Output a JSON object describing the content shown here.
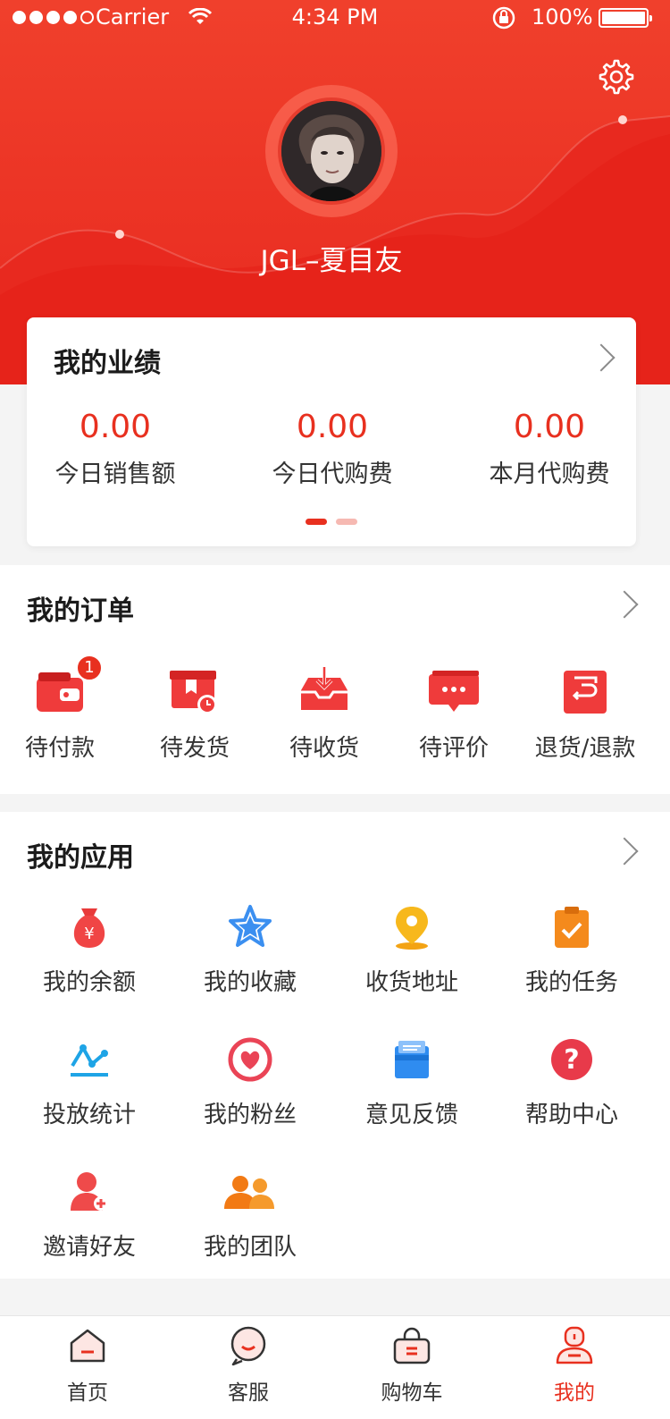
{
  "status_bar": {
    "carrier": "Carrier",
    "time": "4:34 PM",
    "battery": "100%"
  },
  "profile": {
    "username": "JGL–夏目友"
  },
  "performance": {
    "title": "我的业绩",
    "stats": [
      {
        "value": "0.00",
        "label": "今日销售额"
      },
      {
        "value": "0.00",
        "label": "今日代购费"
      },
      {
        "value": "0.00",
        "label": "本月代购费"
      }
    ]
  },
  "orders": {
    "title": "我的订单",
    "items": [
      {
        "label": "待付款",
        "icon": "wallet-icon",
        "badge": "1"
      },
      {
        "label": "待发货",
        "icon": "box-clock-icon"
      },
      {
        "label": "待收货",
        "icon": "inbox-icon"
      },
      {
        "label": "待评价",
        "icon": "chat-icon"
      },
      {
        "label": "退货/退款",
        "icon": "return-icon"
      }
    ]
  },
  "apps": {
    "title": "我的应用",
    "items": [
      {
        "label": "我的余额",
        "icon": "money-bag-icon"
      },
      {
        "label": "我的收藏",
        "icon": "star-icon"
      },
      {
        "label": "收货地址",
        "icon": "location-pin-icon"
      },
      {
        "label": "我的任务",
        "icon": "clipboard-check-icon"
      },
      {
        "label": "投放统计",
        "icon": "line-stats-icon"
      },
      {
        "label": "我的粉丝",
        "icon": "heart-icon"
      },
      {
        "label": "意见反馈",
        "icon": "feedback-icon"
      },
      {
        "label": "帮助中心",
        "icon": "help-icon"
      },
      {
        "label": "邀请好友",
        "icon": "add-user-icon"
      },
      {
        "label": "我的团队",
        "icon": "team-icon"
      }
    ]
  },
  "tabbar": {
    "items": [
      {
        "label": "首页",
        "icon": "home-icon"
      },
      {
        "label": "客服",
        "icon": "service-icon"
      },
      {
        "label": "购物车",
        "icon": "cart-icon"
      },
      {
        "label": "我的",
        "icon": "user-icon",
        "active": true
      }
    ]
  },
  "colors": {
    "accent": "#e8301f",
    "header": "#f0402c"
  }
}
